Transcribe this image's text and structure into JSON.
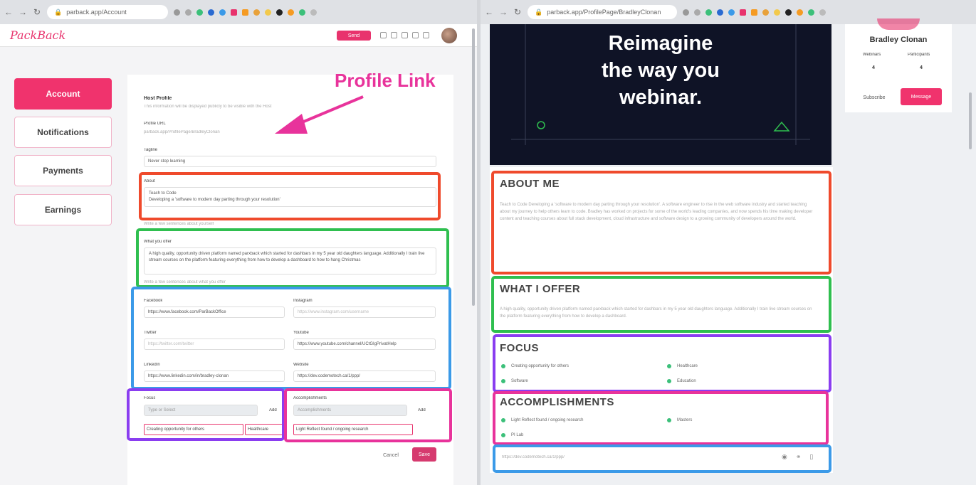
{
  "left_browser": {
    "url": "parback.app/Account",
    "app_logo": "PackBack",
    "send_label": "Send",
    "sidebar": [
      {
        "label": "Account",
        "active": true
      },
      {
        "label": "Notifications",
        "active": false
      },
      {
        "label": "Payments",
        "active": false
      },
      {
        "label": "Earnings",
        "active": false
      }
    ],
    "form": {
      "section_title": "Host Profile",
      "section_subtitle": "This information will be displayed publicly to be visible with the Host",
      "profile_link_label": "Profile URL",
      "profile_link_value": "parback.app/ProfilePage/BradleyClonan",
      "tagline_label": "Tagline",
      "tagline_value": "Never stop learning",
      "about_label": "About",
      "about_line1": "Teach to Code",
      "about_line2": "Developing a 'software to modern day parting through your resolution'",
      "about_hint": "Write a few sentences about yourself",
      "offer_label": "What you offer",
      "offer_text": "A high quality, opportunity driven platform named parxback which started for dashbars in my 5 year old daughters language. Additionally I train live stream courses on the platform featuring everything from how to develop a dashboard to how to hang Christmas",
      "offer_hint": "Write a few sentences about what you offer",
      "facebook_label": "Facebook",
      "facebook_value": "https://www.facebook.com/ParBackOffice",
      "instagram_label": "Instagram",
      "instagram_placeholder": "https://www.instagram.com/username",
      "twitter_label": "Twitter",
      "twitter_placeholder": "https://twitter.com/twitter",
      "youtube_label": "Youtube",
      "youtube_value": "https://www.youtube.com/channel/UCtGIgPrivatHelp",
      "linkedin_label": "LinkedIn",
      "linkedin_value": "https://www.linkedin.com/in/bradley-clonan",
      "website_label": "Website",
      "website_value": "https://dev.codemotech.ca/1/ppp/",
      "focus_label": "Focus",
      "focus_placeholder": "Type or Select",
      "focus_add": "Add",
      "focus_tags": [
        "Creating opportunity for others",
        "Healthcare"
      ],
      "accomplishments_label": "Accomplishments",
      "accomplishments_placeholder": "Accomplishments",
      "accomplishments_add": "Add",
      "accomplishments_tags": [
        "Light Reflect found / ongoing research"
      ],
      "cancel_label": "Cancel",
      "save_label": "Save"
    },
    "annotation": "Profile Link"
  },
  "right_browser": {
    "url": "parback.app/ProfilePage/BradleyClonan",
    "hero_line1": "Reimagine",
    "hero_line2": "the way you",
    "hero_line3": "webinar.",
    "host_name": "Bradley Clonan",
    "stat1_label": "Webinars",
    "stat1_value": "4",
    "stat2_label": "Participants",
    "stat2_value": "4",
    "subscribe_label": "Subscribe",
    "message_label": "Message",
    "about_title": "ABOUT ME",
    "about_text": "Teach to Code Developing a 'software to modern day parting through your resolution'. A software engineer to rise in the web software industry and started teaching about my journey to help others learn to code. Bradley has worked on projects for some of the world's leading companies, and now spends his time making developer content and teaching courses about full stack development, cloud infrastructure and software design to a growing community of developers around the world.",
    "offer_title": "WHAT I OFFER",
    "offer_text": "A high quality, opportunity driven platform named parxback which started for dashbars in my 5 year old daughters language. Additionally I train live stream courses on the platform featuring everything from how to develop a dashboard.",
    "focus_title": "FOCUS",
    "focus_items": [
      "Creating opportunity for others",
      "Healthcare",
      "Software",
      "Education"
    ],
    "accomplishments_title": "ACCOMPLISHMENTS",
    "accomplishments_items": [
      "Light Reflect found / ongoing research",
      "Masters",
      "PI Lab"
    ],
    "link_value": "https://dev.codemotech.ca/1/ppp/"
  },
  "colors": {
    "brand": "#e8336d",
    "red": "#ef4a2c",
    "green": "#2fbf4f",
    "blue": "#3b9ae8",
    "purple": "#8a3df0",
    "pink": "#e8339b"
  }
}
